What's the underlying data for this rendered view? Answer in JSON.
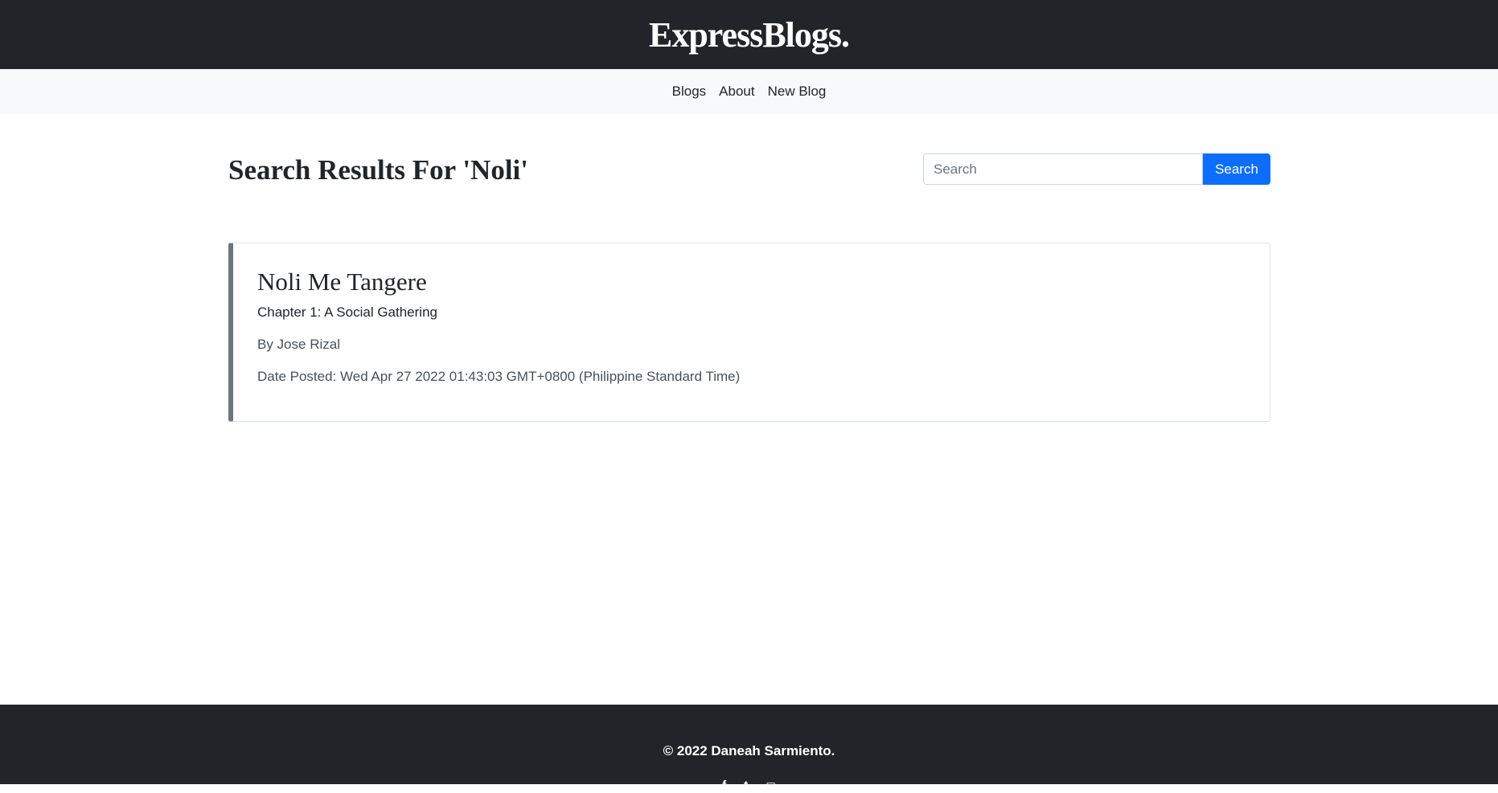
{
  "header": {
    "brand": "ExpressBlogs."
  },
  "nav": {
    "items": [
      "Blogs",
      "About",
      "New Blog"
    ]
  },
  "page": {
    "title": "Search Results For 'Noli'"
  },
  "search": {
    "placeholder": "Search",
    "value": "",
    "button_label": "Search",
    "button_color": "#0d6efd"
  },
  "results": [
    {
      "title": "Noli Me Tangere",
      "subtitle": "Chapter 1: A Social Gathering",
      "author": "By Jose Rizal",
      "date": "Date Posted: Wed Apr 27 2022 01:43:03 GMT+0800 (Philippine Standard Time)"
    }
  ],
  "footer": {
    "copyright": "© 2022 Daneah Sarmiento.",
    "social_icons": [
      "facebook-icon",
      "twitter-icon",
      "instagram-icon"
    ]
  },
  "colors": {
    "dark": "#212529",
    "light_nav": "#f8f9fa",
    "card_accent": "#6c757d"
  }
}
